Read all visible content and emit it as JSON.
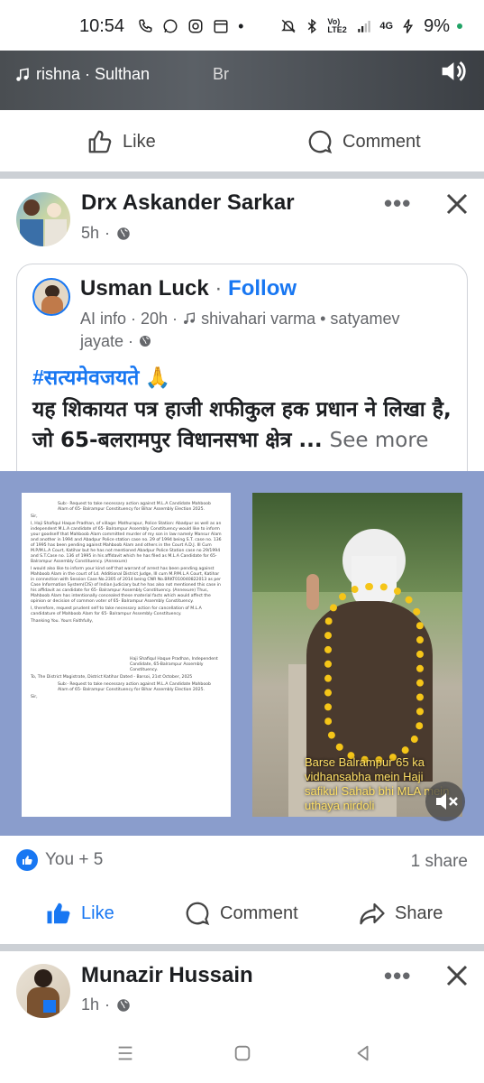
{
  "status_bar": {
    "time": "10:54",
    "network": "Vo) LTE2",
    "signal": "4G",
    "battery": "9%"
  },
  "reel": {
    "music_text": "rishna · Sulthan",
    "side_text": "Br"
  },
  "prev_post": {
    "like_label": "Like",
    "comment_label": "Comment"
  },
  "post": {
    "author": "Drx Askander Sarkar",
    "time": "5h",
    "shared": {
      "author": "Usman Luck",
      "follow_label": "Follow",
      "separator": " · ",
      "meta_line1": "AI info · 20h · ",
      "audio": "shivahari varma • satyamev",
      "meta_line2": "jayate · ",
      "hashtag": "#सत्यमेवजयते 🙏",
      "body": "यह शिकायत पत्र हाजी शफीकुल हक प्रधान ने लिखा है, जो 65-बलरामपुर विधानसभा क्षेत्र ...",
      "see_more": "See more"
    },
    "media": {
      "doc_lines": [
        "Sub:- Request to take necessary action against M.L.A Candidate Mahboob Alam of 65- Balrampur Constituency for Bihar Assembly Election 2025.",
        "Sir,",
        "I, Haji Shafiqul Haque Pradhan, of village: Mathurapur, Police Station: Abadpur as well as an independent M.L.A candidate of 65- Balrampur Assembly Constituency would like to inform your goodself that Mahboob Alam committed murder of my son in law namely Mansur Alam and another in 1994 and Abadpur Police station case no. 29 of 1994 being S.T. case no. 136 of 1995 has been pending against Mahboob Alam and others in the Court A.D.J. III Cum M.P/M.L.A Court, Katihar but he has not mentioned Abadpur Police Station case no 29/1994 and S.T.Case no. 136 of 1995 in his affidavit which he has filed as M.L.A Candidate for 65- Balrampur Assembly Constituency. (Annexure)",
        "I would also like to inform your kind self that warrant of arrest has been pending against Mahboob Alam in the court of Ld. Additional District Judge, III cum M.P/M.L.A Court, Katihar in connection with Session Case No.2305 of 2014 being CNR No.BRKT010040822013 as per Case Information System(CIS) of Indian Judiciary but he has also not mentioned this case in his affidavit as candidate for 65- Balrampur Assembly Constituency. (Annexure) Thus, Mahboob Alam has intentionally concealed these material facts which would affect the opinion or decision of common voter of 65- Balrampur Assembly Constituency.",
        "I, therefore, request prudent self to take necessary action for cancellation of M.L.A candidature of Mahboob Alam for 65- Balrampur Assembly Constituency.",
        "Thanking You.                                         Yours Faithfully,",
        "Haji Shafiqul Haque Pradhan, Independent Candidate, 65-Balrampur Assembly Constituency.",
        "To, The District Magistrate, District Katihar            Dated - Barsoi, 21st October, 2025",
        "Sub:- Request to take necessary action against M.L.A Candidate Mahboob Alam of 65- Balrampur Constituency for Bihar Assembly Election 2025.",
        "Sir,"
      ],
      "video_caption": "Barse Balrampur 65 ka vidhansabha mein Haji safikul Sahab bhi MLA mein uthaya nirdoli"
    },
    "reactions_text": "You + 5",
    "shares_text": "1 share",
    "like_label": "Like",
    "comment_label": "Comment",
    "share_label": "Share"
  },
  "next_post": {
    "author": "Munazir Hussain",
    "time": "1h"
  },
  "colors": {
    "facebook_blue": "#1877f2",
    "secondary_text": "#65676b",
    "separator_gray": "#ccd0d5",
    "media_bg": "#8a9dcc"
  }
}
